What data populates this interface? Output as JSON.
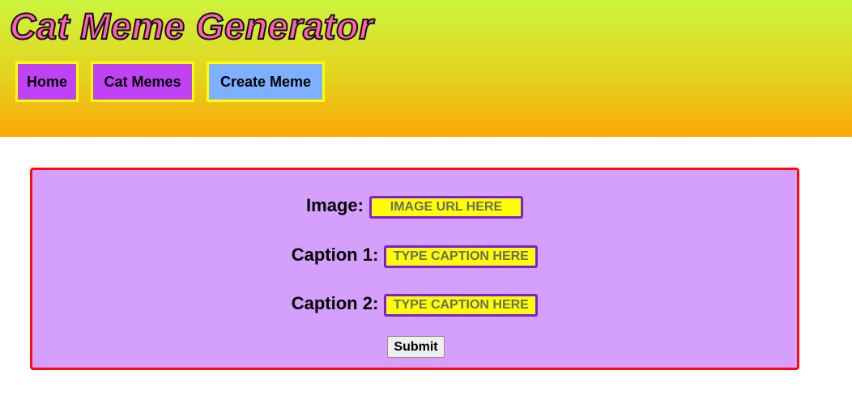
{
  "header": {
    "title": "Cat Meme Generator",
    "nav": [
      {
        "label": "Home"
      },
      {
        "label": "Cat Memes"
      },
      {
        "label": "Create Meme",
        "active": true
      }
    ]
  },
  "form": {
    "fields": [
      {
        "label": "Image:",
        "placeholder": "IMAGE URL HERE",
        "value": ""
      },
      {
        "label": "Caption 1:",
        "placeholder": "TYPE CAPTION HERE",
        "value": ""
      },
      {
        "label": "Caption 2:",
        "placeholder": "TYPE CAPTION HERE",
        "value": ""
      }
    ],
    "submit_label": "Submit"
  },
  "colors": {
    "header_top": "#ccf53d",
    "header_bottom": "#fba806",
    "title_fill": "#ff5fb4",
    "nav_button": "#c042f5",
    "nav_active": "#7fb0ff",
    "nav_border": "#ffff00",
    "form_background": "#d59ffc",
    "form_border": "#ff0a0a",
    "input_background": "#ffff00",
    "input_border": "#7a1fd6"
  }
}
